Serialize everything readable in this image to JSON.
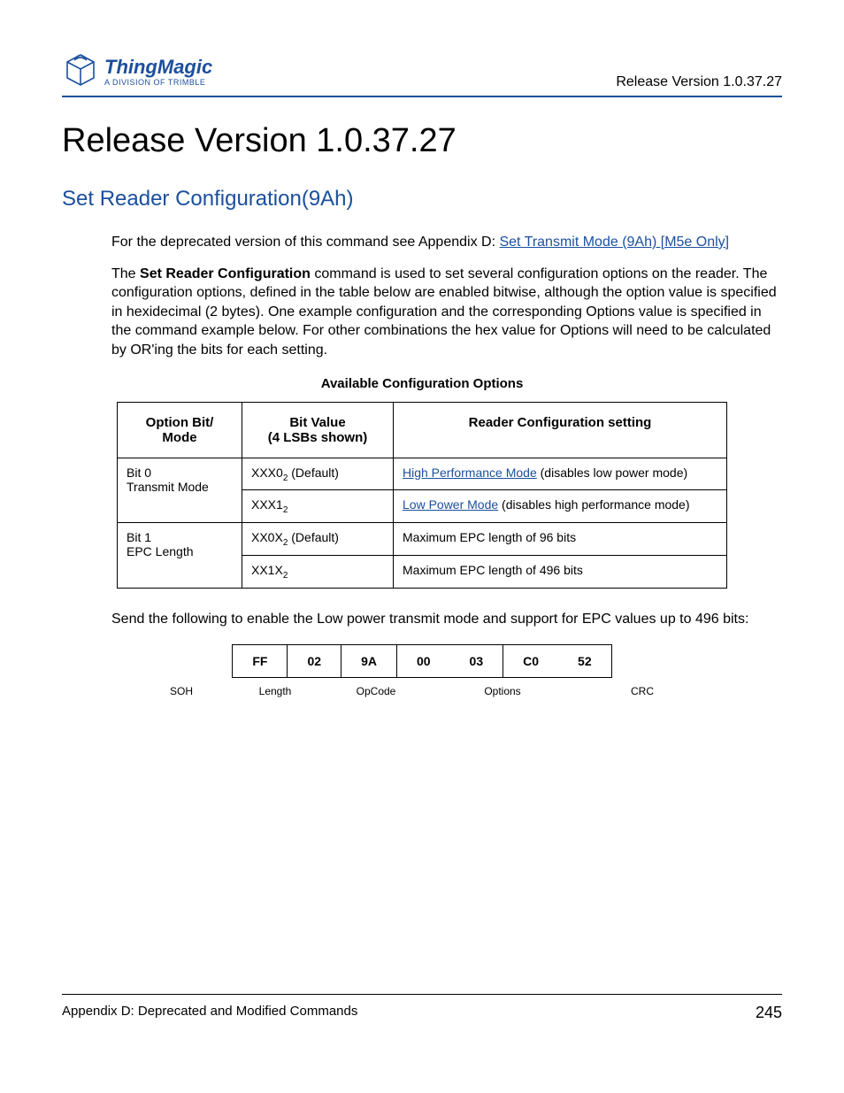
{
  "header": {
    "brand": "ThingMagic",
    "division": "A DIVISION OF TRIMBLE",
    "right": "Release Version 1.0.37.27"
  },
  "title": "Release Version 1.0.37.27",
  "section_heading": "Set Reader Configuration(9Ah)",
  "intro_prefix": "For the deprecated version of this command see Appendix D: ",
  "intro_link": "Set Transmit Mode (9Ah) [M5e Only]",
  "para2_a": "The ",
  "para2_bold": "Set Reader Configuration",
  "para2_b": " command is used to set several configuration options on the reader. The configuration options, defined in the table below are enabled bitwise, although the option value is specified in hexidecimal (2 bytes). One example configuration and the corresponding Options value is specified in the command example below. For other combinations the hex value for Options will need to be calculated by OR'ing the bits for each setting.",
  "table_caption": "Available Configuration Options",
  "table": {
    "headers": [
      "Option Bit/\nMode",
      "Bit Value\n(4 LSBs shown)",
      "Reader Configuration setting"
    ],
    "rows": [
      {
        "mode": "Bit 0\nTransmit Mode",
        "value_prefix": "XXX0",
        "value_suffix": " (Default)",
        "setting_link": "High Performance Mode",
        "setting_rest": " (disables low power mode)"
      },
      {
        "mode": "",
        "value_prefix": "XXX1",
        "value_suffix": "",
        "setting_link": "Low Power Mode",
        "setting_rest": " (disables high performance mode)"
      },
      {
        "mode": "Bit 1\nEPC Length",
        "value_prefix": "XX0X",
        "value_suffix": " (Default)",
        "setting_link": "",
        "setting_rest": "Maximum EPC length of 96 bits"
      },
      {
        "mode": "",
        "value_prefix": "XX1X",
        "value_suffix": "",
        "setting_link": "",
        "setting_rest": "Maximum EPC length of 496 bits"
      }
    ]
  },
  "para3": "Send the following to enable the Low power transmit mode and support for EPC values up to 496 bits:",
  "cmd": {
    "cells": [
      "FF",
      "02",
      "9A",
      "00",
      "03",
      "C0",
      "52"
    ],
    "labels": [
      "SOH",
      "Length",
      "OpCode",
      "Options",
      "CRC"
    ]
  },
  "footer": {
    "left": "Appendix D: Deprecated and Modified Commands",
    "page": "245"
  }
}
